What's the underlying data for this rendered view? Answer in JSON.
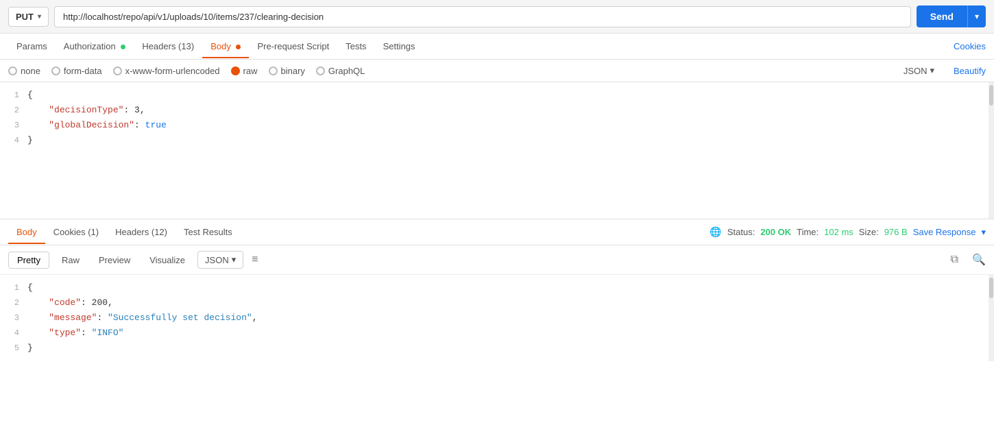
{
  "topbar": {
    "method": "PUT",
    "url": "http://localhost/repo/api/v1/uploads/10/items/237/clearing-decision",
    "send_label": "Send"
  },
  "request_tabs": [
    {
      "id": "params",
      "label": "Params",
      "active": false,
      "dot": null
    },
    {
      "id": "authorization",
      "label": "Authorization",
      "active": false,
      "dot": "green"
    },
    {
      "id": "headers",
      "label": "Headers (13)",
      "active": false,
      "dot": null
    },
    {
      "id": "body",
      "label": "Body",
      "active": true,
      "dot": "orange"
    },
    {
      "id": "prerequest",
      "label": "Pre-request Script",
      "active": false,
      "dot": null
    },
    {
      "id": "tests",
      "label": "Tests",
      "active": false,
      "dot": null
    },
    {
      "id": "settings",
      "label": "Settings",
      "active": false,
      "dot": null
    }
  ],
  "cookies_link": "Cookies",
  "body_types": [
    {
      "id": "none",
      "label": "none",
      "selected": false
    },
    {
      "id": "form-data",
      "label": "form-data",
      "selected": false
    },
    {
      "id": "urlencoded",
      "label": "x-www-form-urlencoded",
      "selected": false
    },
    {
      "id": "raw",
      "label": "raw",
      "selected": true
    },
    {
      "id": "binary",
      "label": "binary",
      "selected": false
    },
    {
      "id": "graphql",
      "label": "GraphQL",
      "selected": false
    }
  ],
  "body_json_label": "JSON",
  "beautify_label": "Beautify",
  "request_body": [
    {
      "line": 1,
      "content": "{"
    },
    {
      "line": 2,
      "content": "    \"decisionType\": 3,"
    },
    {
      "line": 3,
      "content": "    \"globalDecision\": true"
    },
    {
      "line": 4,
      "content": "}"
    }
  ],
  "response_tabs": [
    {
      "id": "body",
      "label": "Body",
      "active": true
    },
    {
      "id": "cookies",
      "label": "Cookies (1)",
      "active": false
    },
    {
      "id": "headers",
      "label": "Headers (12)",
      "active": false
    },
    {
      "id": "test-results",
      "label": "Test Results",
      "active": false
    }
  ],
  "status": {
    "label": "Status:",
    "value": "200 OK",
    "time_label": "Time:",
    "time_value": "102 ms",
    "size_label": "Size:",
    "size_value": "976 B"
  },
  "save_response_label": "Save Response",
  "response_formats": [
    "Pretty",
    "Raw",
    "Preview",
    "Visualize"
  ],
  "response_json_label": "JSON",
  "response_body": [
    {
      "line": 1,
      "content": "{"
    },
    {
      "line": 2,
      "content": "    \"code\": 200,"
    },
    {
      "line": 3,
      "content": "    \"message\": \"Successfully set decision\","
    },
    {
      "line": 4,
      "content": "    \"type\": \"INFO\""
    },
    {
      "line": 5,
      "content": "}"
    }
  ]
}
